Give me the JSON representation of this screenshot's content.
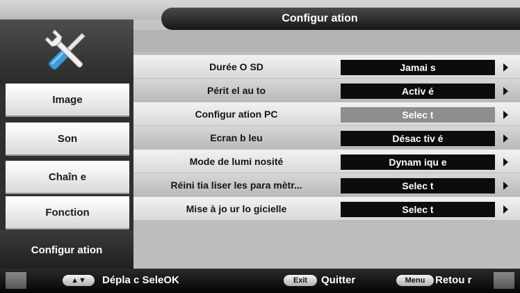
{
  "header": {
    "title": "Configur ation"
  },
  "sidebar": {
    "icon": "tools-icon",
    "items": [
      {
        "label": "Image"
      },
      {
        "label": "Son"
      },
      {
        "label": "Chaîn e"
      },
      {
        "label": "Fonction"
      },
      {
        "label": "Configur ation",
        "selected": true
      }
    ]
  },
  "settings": [
    {
      "label": "Durée O SD",
      "value": "Jamai s"
    },
    {
      "label": "Périt el au to",
      "value": "Activ é"
    },
    {
      "label": "Configur ation PC",
      "value": "Selec t",
      "disabled": true
    },
    {
      "label": "Ecran b leu",
      "value": "Désac tiv é"
    },
    {
      "label": "Mode de lumi nosité",
      "value": "Dynam iqu e"
    },
    {
      "label": "Réini tia liser les para mètr...",
      "value": "Selec t"
    },
    {
      "label": "Mise à jo ur lo gicielle",
      "value": "Selec t"
    }
  ],
  "footer": {
    "nav_key": "▲▼",
    "nav_label": "Dépla c Sele",
    "ok_key": "OK",
    "exit_key": "Exit",
    "exit_label": "Quitter",
    "menu_key": "Menu",
    "menu_label": "Retou r"
  },
  "colors": {
    "panel_dark": "#2f2f2f",
    "value_box": "#0c0c0c",
    "value_box_disabled": "#8e8e8e",
    "content_bg": "#bdbdbd",
    "icon_blue": "#3d9bd6"
  }
}
